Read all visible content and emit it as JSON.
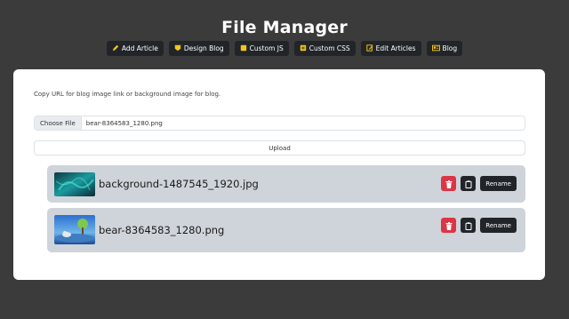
{
  "header": {
    "title": "File Manager"
  },
  "nav": [
    {
      "label": "Add Article",
      "icon": "pencil-icon"
    },
    {
      "label": "Design Blog",
      "icon": "shield-icon"
    },
    {
      "label": "Custom JS",
      "icon": "file-js-icon"
    },
    {
      "label": "Custom CSS",
      "icon": "file-css-icon"
    },
    {
      "label": "Edit Articles",
      "icon": "edit-icon"
    },
    {
      "label": "Blog",
      "icon": "newspaper-icon"
    }
  ],
  "upload": {
    "hint": "Copy URL for blog image link or background image for blog.",
    "choose_label": "Choose File",
    "selected_file": "bear-8364583_1280.png",
    "upload_label": "Upload"
  },
  "files": [
    {
      "name": "background-1487545_1920.jpg",
      "rename_label": "Rename"
    },
    {
      "name": "bear-8364583_1280.png",
      "rename_label": "Rename"
    }
  ],
  "colors": {
    "background": "#3b3b3b",
    "danger": "#dc3545",
    "dark": "#212529",
    "accent": "#f5c518"
  }
}
